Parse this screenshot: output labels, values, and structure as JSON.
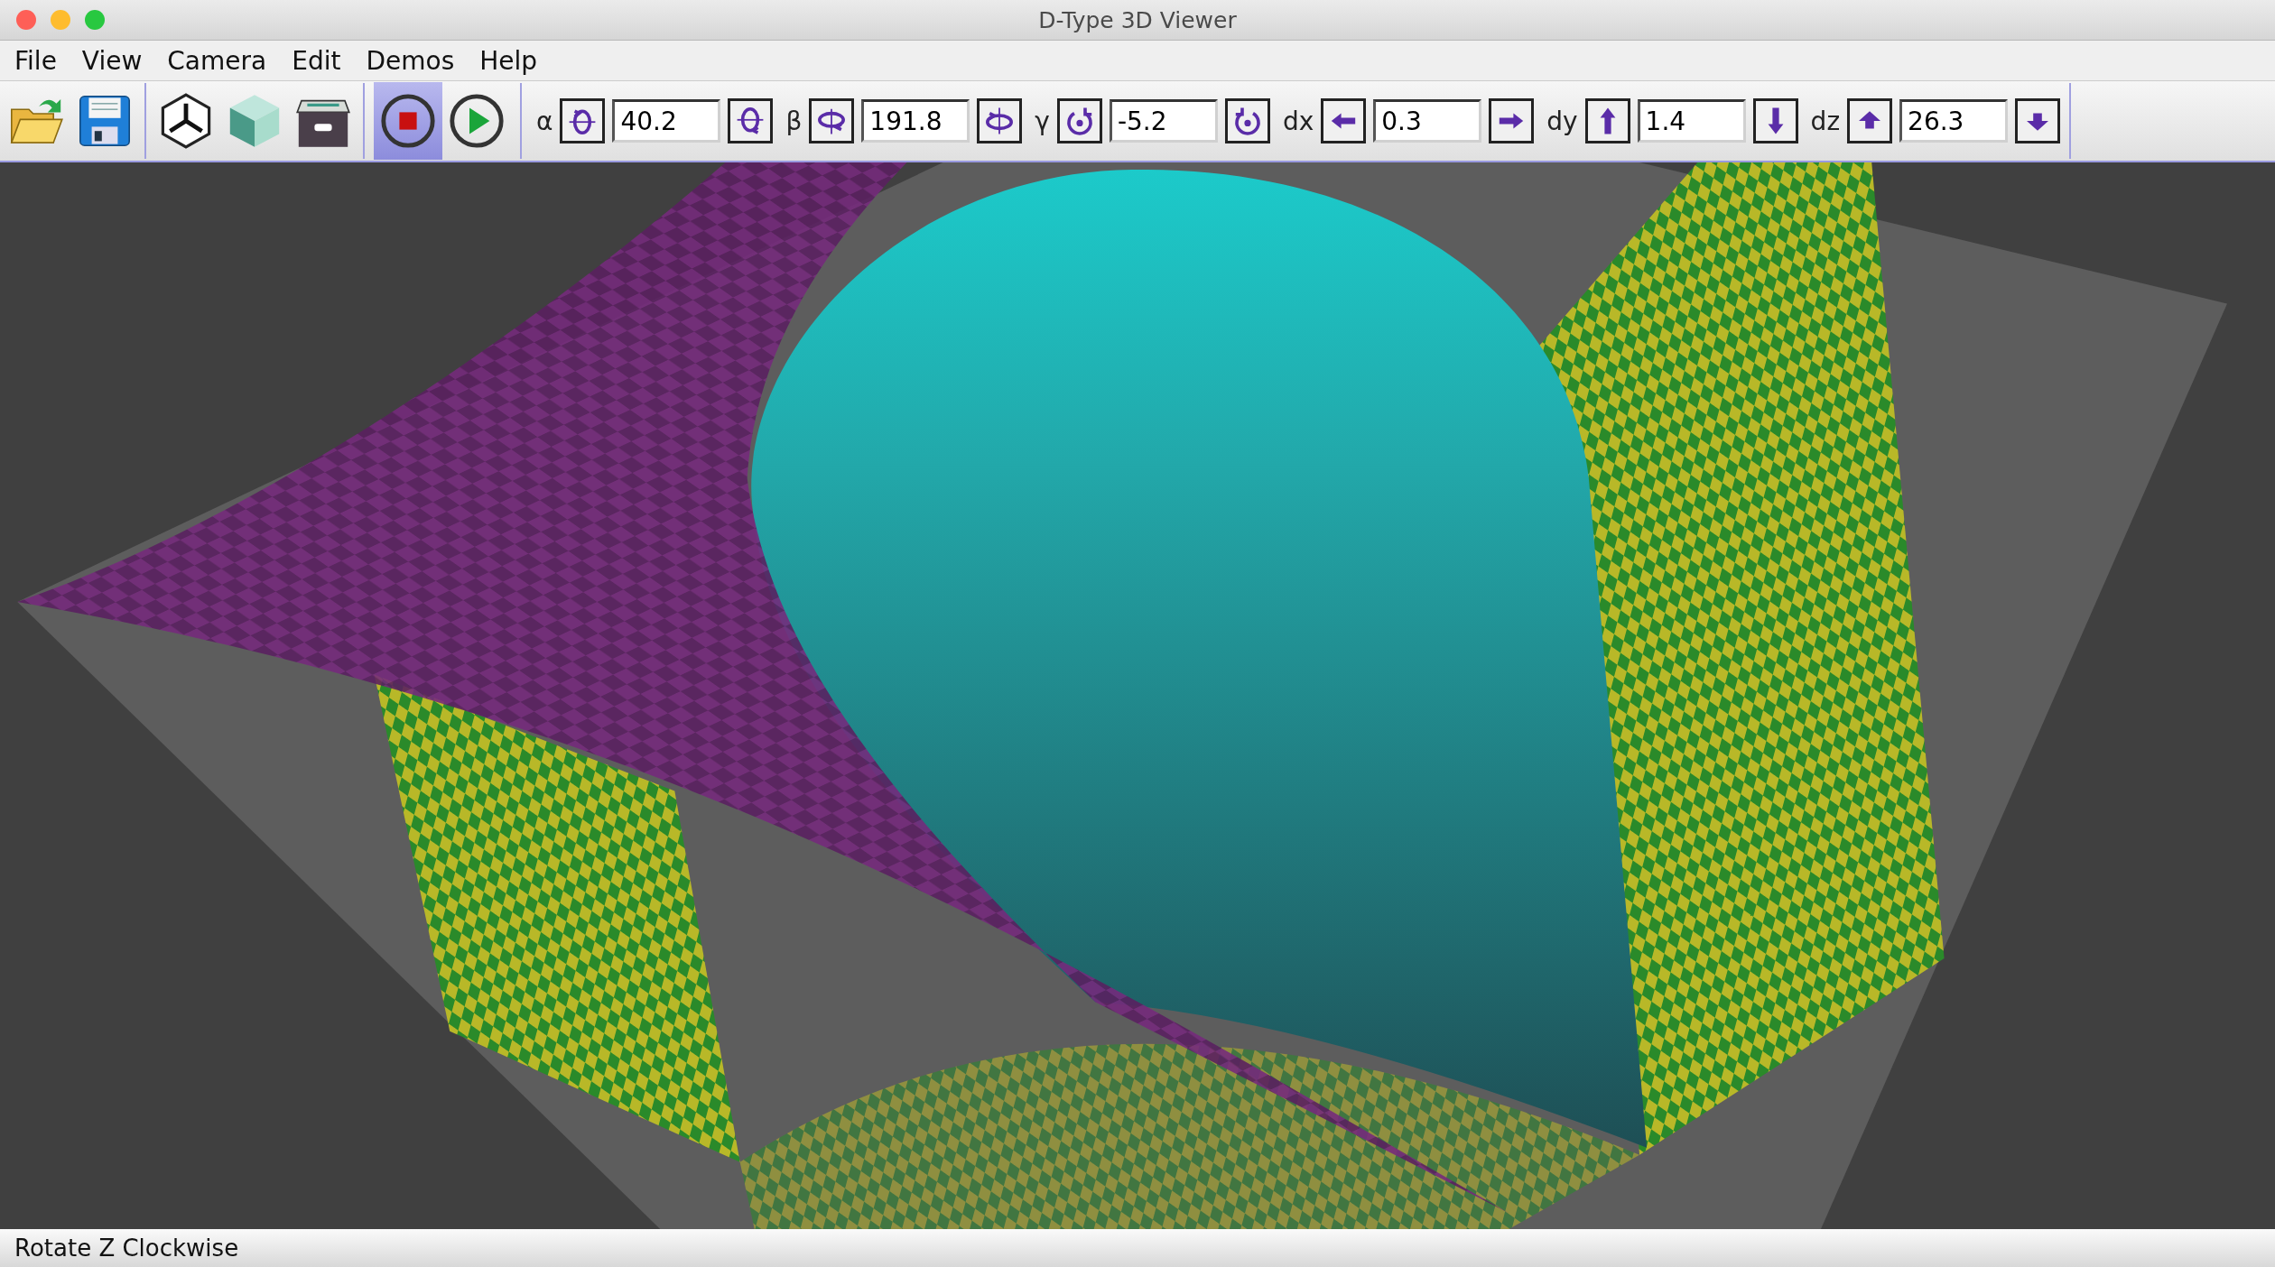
{
  "window": {
    "title": "D-Type 3D Viewer"
  },
  "menu": [
    "File",
    "View",
    "Camera",
    "Edit",
    "Demos",
    "Help"
  ],
  "toolbar": {
    "tools": [
      {
        "kind": "open"
      },
      {
        "kind": "save"
      },
      {
        "kind": "axes"
      },
      {
        "kind": "cube"
      },
      {
        "kind": "archive"
      }
    ],
    "playback": [
      {
        "kind": "stop",
        "selected": true
      },
      {
        "kind": "play",
        "selected": false
      }
    ],
    "controls": [
      {
        "kind": "rot-x",
        "label": "α",
        "value": "40.2"
      },
      {
        "kind": "rot-y",
        "label": "β",
        "value": "191.8"
      },
      {
        "kind": "rot-z",
        "label": "γ",
        "value": "-5.2"
      },
      {
        "kind": "move-x",
        "label": "dx",
        "value": "0.3"
      },
      {
        "kind": "move-y",
        "label": "dy",
        "value": "1.4"
      },
      {
        "kind": "move-z",
        "label": "dz",
        "value": "26.3"
      }
    ]
  },
  "status_bar": "Rotate Z Clockwise"
}
